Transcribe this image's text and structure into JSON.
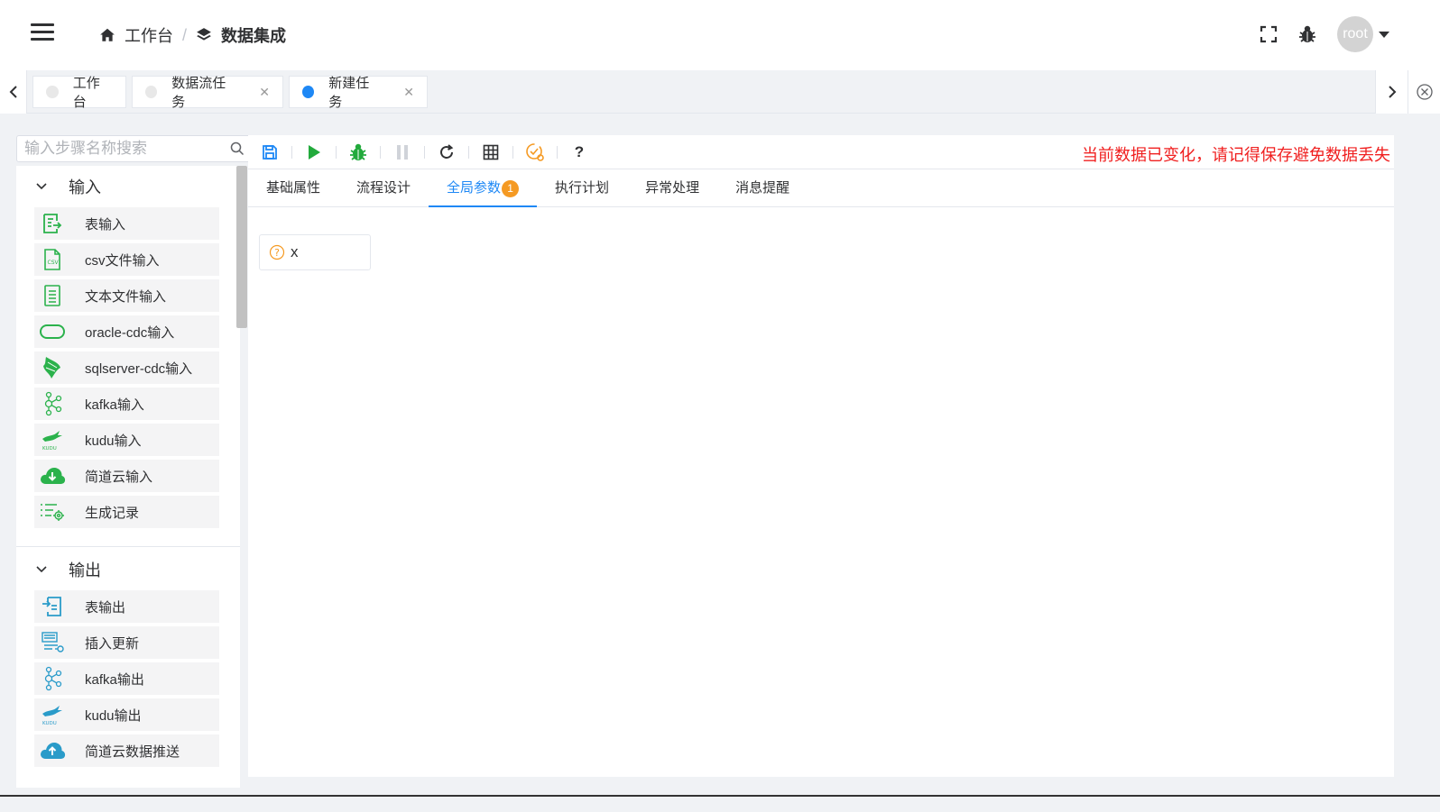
{
  "header": {
    "breadcrumb": [
      {
        "label": "工作台",
        "icon": "home-icon"
      },
      {
        "label": "数据集成",
        "icon": "layers-icon"
      }
    ],
    "user": {
      "avatar_text": "root"
    }
  },
  "tabs": [
    {
      "label": "工作台",
      "closable": false,
      "active": false
    },
    {
      "label": "数据流任务",
      "closable": true,
      "active": false
    },
    {
      "label": "新建任务",
      "closable": true,
      "active": true
    }
  ],
  "search": {
    "placeholder": "输入步骤名称搜索"
  },
  "step_groups": [
    {
      "title": "输入",
      "items": [
        {
          "label": "表输入",
          "icon": "table-input-icon"
        },
        {
          "label": "csv文件输入",
          "icon": "csv-file-icon"
        },
        {
          "label": "文本文件输入",
          "icon": "text-file-icon"
        },
        {
          "label": "oracle-cdc输入",
          "icon": "oracle-icon"
        },
        {
          "label": "sqlserver-cdc输入",
          "icon": "sqlserver-icon"
        },
        {
          "label": "kafka输入",
          "icon": "kafka-icon"
        },
        {
          "label": "kudu输入",
          "icon": "kudu-icon"
        },
        {
          "label": "简道云输入",
          "icon": "cloud-download-icon"
        },
        {
          "label": "生成记录",
          "icon": "generate-records-icon"
        }
      ]
    },
    {
      "title": "输出",
      "items": [
        {
          "label": "表输出",
          "icon": "table-output-icon"
        },
        {
          "label": "插入更新",
          "icon": "insert-update-icon"
        },
        {
          "label": "kafka输出",
          "icon": "kafka-icon"
        },
        {
          "label": "kudu输出",
          "icon": "kudu-icon"
        },
        {
          "label": "简道云数据推送",
          "icon": "cloud-upload-icon"
        }
      ]
    }
  ],
  "toolbar": {
    "warning": "当前数据已变化，请记得保存避免数据丢失",
    "help_label": "?"
  },
  "subtabs": [
    {
      "label": "基础属性"
    },
    {
      "label": "流程设计"
    },
    {
      "label": "全局参数",
      "badge": "1",
      "active": true
    },
    {
      "label": "执行计划"
    },
    {
      "label": "异常处理"
    },
    {
      "label": "消息提醒"
    }
  ],
  "params": [
    {
      "name": "x",
      "icon": "question-circle-icon"
    }
  ],
  "colors": {
    "accent": "#1e88f5",
    "warning_text": "#f02020",
    "badge": "#f59a23",
    "input_icon": "#2bb24c",
    "output_icon": "#2a9bc9"
  }
}
